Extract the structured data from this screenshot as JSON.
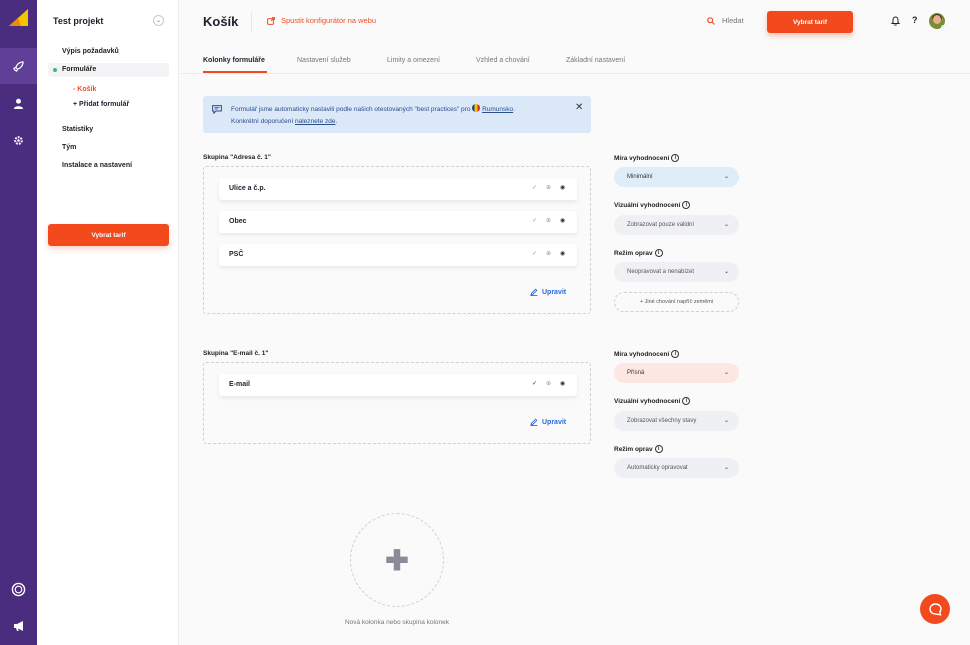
{
  "sidebar": {
    "project": "Test projekt",
    "items": [
      {
        "label": "Výpis požadavků"
      },
      {
        "label": "Formuláře"
      },
      {
        "label": "Statistiky"
      },
      {
        "label": "Tým"
      },
      {
        "label": "Instalace a nastavení"
      }
    ],
    "subitems": [
      {
        "label": "- Košík"
      },
      {
        "label": "+ Přidat formulář"
      }
    ],
    "cta": "Vybrat tarif"
  },
  "header": {
    "title": "Košík",
    "launch": "Spustit konfigurátor na webu",
    "search": "Hledat",
    "cta": "Vybrat tarif",
    "help": "?"
  },
  "tabs": [
    {
      "label": "Kolonky formuláře"
    },
    {
      "label": "Nastavení služeb"
    },
    {
      "label": "Limity a omezení"
    },
    {
      "label": "Vzhled a chování"
    },
    {
      "label": "Základní nastavení"
    }
  ],
  "info": {
    "line1": "Formulář jsme automaticky nastavili podle našich otestovaných \"best practices\" pro",
    "country": "Rumunsko",
    "line1_end": ".",
    "line2": "Konkrétní doporučení",
    "link": "naleznete zde",
    "line2_end": ".",
    "close": "✕"
  },
  "groups": [
    {
      "label": "Skupina \"Adresa č. 1\"",
      "fields": [
        {
          "name": "Ulice a č.p."
        },
        {
          "name": "Obec"
        },
        {
          "name": "PSČ"
        }
      ],
      "edit": "Upravit",
      "settings": {
        "strictness_label": "Míra vyhodnocení",
        "strictness_value": "Minimální",
        "visual_label": "Vizuální vyhodnocení",
        "visual_value": "Zobrazovat pouze validní",
        "fix_label": "Režim oprav",
        "fix_value": "Neopravovat a nenabízet",
        "add_behavior": "+ Jiné chování napříč zeměmi"
      }
    },
    {
      "label": "Skupina \"E-mail č. 1\"",
      "fields": [
        {
          "name": "E-mail"
        }
      ],
      "edit": "Upravit",
      "settings": {
        "strictness_label": "Míra vyhodnocení",
        "strictness_value": "Přísná",
        "visual_label": "Vizuální vyhodnocení",
        "visual_value": "Zobrazovat všechny stavy",
        "fix_label": "Režim oprav",
        "fix_value": "Automaticky opravovat"
      }
    }
  ],
  "new_column": "Nová kolonka nebo skupina kolonek",
  "colors": {
    "accent": "#f24a1d",
    "rail": "#4b2d7f",
    "info_bg": "#dbe8f8",
    "link": "#2a6ad8"
  }
}
